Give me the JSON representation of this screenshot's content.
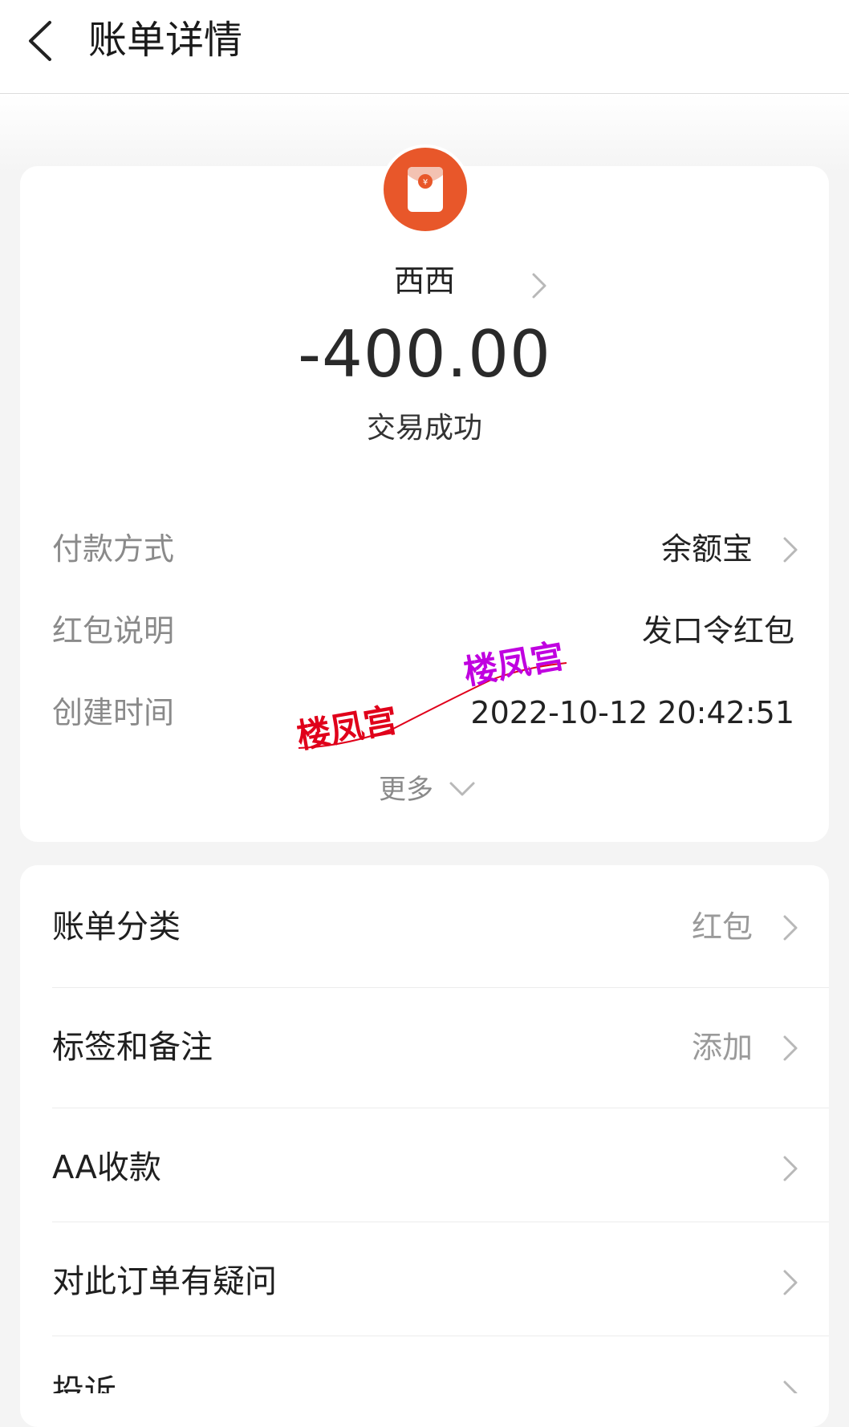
{
  "header": {
    "title": "账单详情"
  },
  "payee": {
    "name": "西西",
    "avatar_icon": "red-envelope-icon",
    "avatar_color": "#e8572a"
  },
  "amount": "-400.00",
  "status": "交易成功",
  "details": [
    {
      "label": "付款方式",
      "value": "余额宝"
    },
    {
      "label": "红包说明",
      "value": "发口令红包"
    },
    {
      "label": "创建时间",
      "value": "2022-10-12 20:42:51"
    }
  ],
  "more_label": "更多",
  "watermark": {
    "text1": "楼凤宫",
    "text2": "楼凤宫",
    "color1": "#e0001a",
    "color2": "#c000e0"
  },
  "list": [
    {
      "label": "账单分类",
      "value": "红包"
    },
    {
      "label": "标签和备注",
      "value": "添加"
    },
    {
      "label": "AA收款",
      "value": ""
    },
    {
      "label": "对此订单有疑问",
      "value": ""
    },
    {
      "label": "投诉",
      "value": ""
    }
  ]
}
